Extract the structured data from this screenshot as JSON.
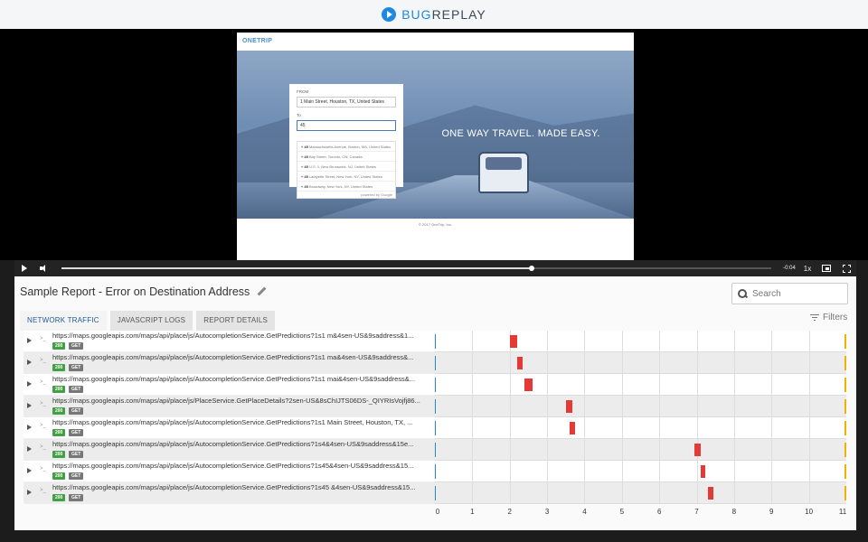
{
  "brand": {
    "part1": "BUG",
    "part2": "REPLAY"
  },
  "site": {
    "logo": "ONETRIP",
    "tagline": "ONE WAY TRAVEL. MADE EASY.",
    "from_label": "FROM",
    "from_value": "1 Main Street, Houston, TX, United States",
    "to_label": "To",
    "to_value": "45",
    "suggestions": [
      {
        "num": "45",
        "text": "Massachusetts Avenue, Boston, MA, United States"
      },
      {
        "num": "45",
        "text": "Bay Street, Toronto, ON, Canada"
      },
      {
        "num": "45",
        "text": "U.S. 1, New Brunswick, NJ, United States"
      },
      {
        "num": "45",
        "text": "Lafayette Street, New York, NY, United States"
      },
      {
        "num": "45",
        "text": "Broadway, New York, NY, United States"
      }
    ],
    "powered": "powered by Google",
    "footer": "© 2017 OneTrip, Inc."
  },
  "player": {
    "time": "-0:04",
    "rate": "1x",
    "progress": 0.663
  },
  "report": {
    "title": "Sample Report - Error on Destination Address",
    "search_placeholder": "Search",
    "filters_label": "Filters",
    "tabs": [
      {
        "label": "NETWORK TRAFFIC",
        "active": true
      },
      {
        "label": "JAVASCRIPT LOGS",
        "active": false
      },
      {
        "label": "REPORT DETAILS",
        "active": false
      }
    ]
  },
  "network": {
    "rows": [
      {
        "url": "https://maps.googleapis.com/maps/api/place/js/AutocompletionService.GetPredictions?1s1 m&4sen-US&9saddress&1...",
        "status": "200",
        "method": "GET",
        "start": 2.0,
        "end": 2.2
      },
      {
        "url": "https://maps.googleapis.com/maps/api/place/js/AutocompletionService.GetPredictions?1s1 ma&4sen-US&9saddress&...",
        "status": "200",
        "method": "GET",
        "start": 2.2,
        "end": 2.35
      },
      {
        "url": "https://maps.googleapis.com/maps/api/place/js/AutocompletionService.GetPredictions?1s1 mai&4sen-US&9saddress&...",
        "status": "200",
        "method": "GET",
        "start": 2.4,
        "end": 2.6
      },
      {
        "url": "https://maps.googleapis.com/maps/api/place/js/PlaceService.GetPlaceDetails?2sen-US&8sChIJTS06DS-_QIYRIsVojfj86...",
        "status": "200",
        "method": "GET",
        "start": 3.5,
        "end": 3.68
      },
      {
        "url": "https://maps.googleapis.com/maps/api/place/js/AutocompletionService.GetPredictions?1s1 Main Street, Houston, TX, ...",
        "status": "200",
        "method": "GET",
        "start": 3.6,
        "end": 3.75
      },
      {
        "url": "https://maps.googleapis.com/maps/api/place/js/AutocompletionService.GetPredictions?1s4&4sen-US&9saddress&15e...",
        "status": "200",
        "method": "GET",
        "start": 6.93,
        "end": 7.1
      },
      {
        "url": "https://maps.googleapis.com/maps/api/place/js/AutocompletionService.GetPredictions?1s45&4sen-US&9saddress&15...",
        "status": "200",
        "method": "GET",
        "start": 7.1,
        "end": 7.18
      },
      {
        "url": "https://maps.googleapis.com/maps/api/place/js/AutocompletionService.GetPredictions?1s45 &4sen-US&9saddress&15...",
        "status": "200",
        "method": "GET",
        "start": 7.3,
        "end": 7.45
      }
    ],
    "axis_ticks": [
      "0",
      "1",
      "2",
      "3",
      "4",
      "5",
      "6",
      "7",
      "8",
      "9",
      "10",
      "11"
    ],
    "axis_max": 11
  },
  "colors": {
    "accent": "#1e88e5",
    "bar": "#e53935",
    "status_ok": "#43a047",
    "method": "#777777"
  }
}
